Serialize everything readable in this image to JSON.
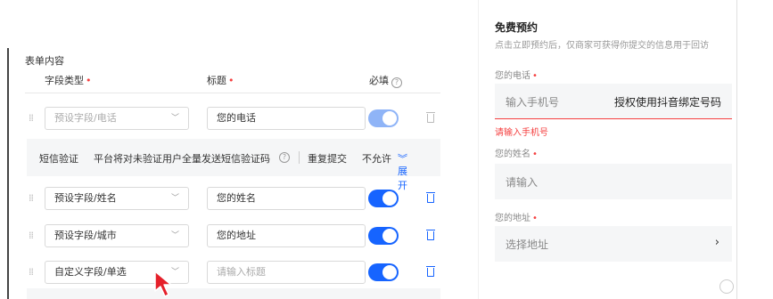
{
  "editor": {
    "section_title": "表单内容",
    "columns": {
      "field_type": "字段类型",
      "title": "标题",
      "required": "必填"
    },
    "rows": [
      {
        "type": "预设字段/电话",
        "title": "您的电话",
        "title_is_placeholder": false,
        "required": true,
        "disabled": true
      },
      {
        "type": "预设字段/姓名",
        "title": "您的姓名",
        "title_is_placeholder": false,
        "required": true,
        "disabled": false
      },
      {
        "type": "预设字段/城市",
        "title": "您的地址",
        "title_is_placeholder": false,
        "required": true,
        "disabled": false
      },
      {
        "type": "自定义字段/单选",
        "title": "请输入标题",
        "title_is_placeholder": true,
        "required": true,
        "disabled": false
      }
    ],
    "sms": {
      "label": "短信验证",
      "desc": "平台将对未验证用户全量发送短信验证码",
      "repeat_label": "重复提交",
      "repeat_value": "不允许",
      "expand": "展开"
    }
  },
  "preview": {
    "title": "免费预约",
    "desc": "点击立即预约后，仅商家可获得你提交的信息用于回访",
    "phone": {
      "label": "您的电话",
      "placeholder": "输入手机号",
      "auth": "授权使用抖音绑定号码",
      "error": "请输入手机号"
    },
    "name": {
      "label": "您的姓名",
      "placeholder": "请输入"
    },
    "address": {
      "label": "您的地址",
      "placeholder": "选择地址"
    }
  },
  "colors": {
    "primary": "#1664ff",
    "error": "#f53f3f",
    "bar": "#f5f6f7"
  }
}
